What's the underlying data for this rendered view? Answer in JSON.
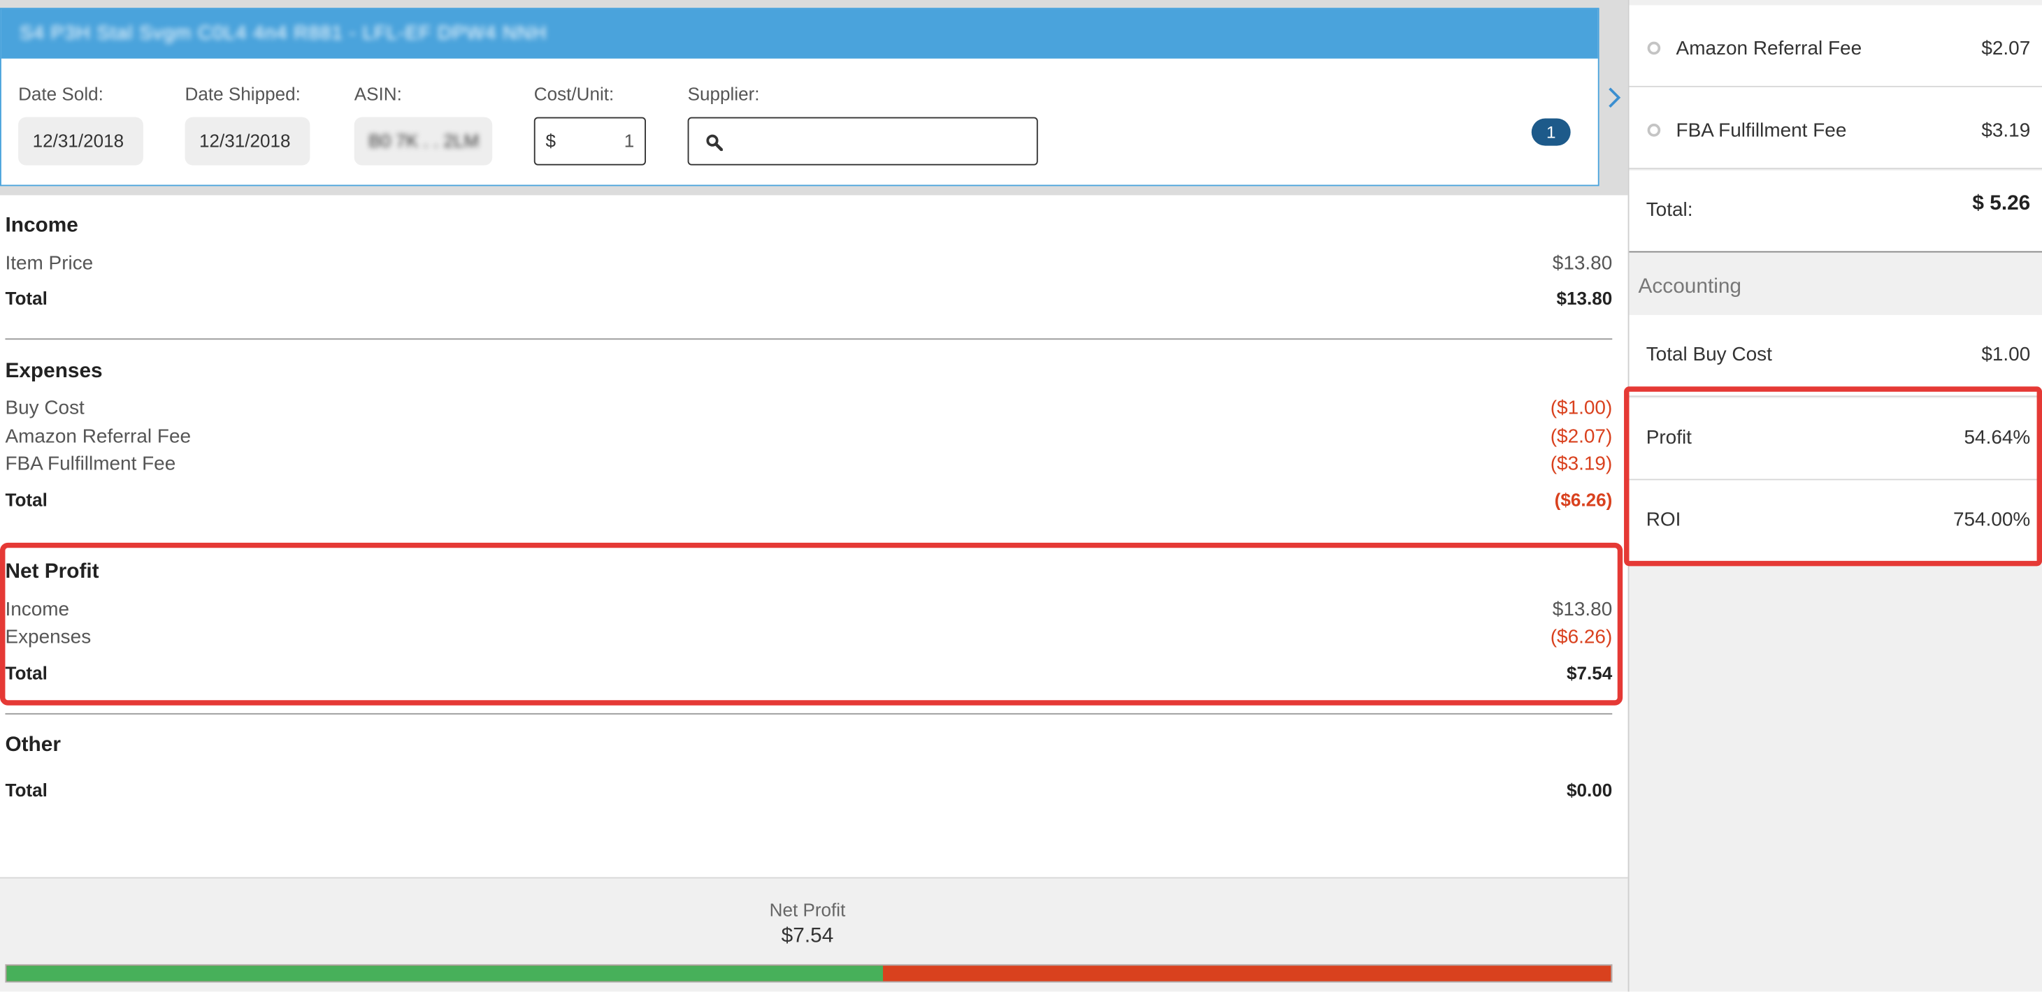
{
  "order_card": {
    "title": "S4 P3H Stal Svgm C0L4 4n4 R881 - LFL-EF DPW4 NNH",
    "date_sold_label": "Date Sold:",
    "date_sold": "12/31/2018",
    "date_shipped_label": "Date Shipped:",
    "date_shipped": "12/31/2018",
    "asin_label": "ASIN:",
    "asin": "B0 7K . . 2LM",
    "cost_unit_label": "Cost/Unit:",
    "cost_currency": "$",
    "cost_value": "1",
    "supplier_label": "Supplier:",
    "supplier_value": "",
    "badge_count": "1"
  },
  "income": {
    "title": "Income",
    "item_price_label": "Item Price",
    "item_price": "$13.80",
    "total_label": "Total",
    "total": "$13.80"
  },
  "expenses": {
    "title": "Expenses",
    "buy_cost_label": "Buy Cost",
    "buy_cost": "($1.00)",
    "referral_label": "Amazon Referral Fee",
    "referral": "($2.07)",
    "fba_label": "FBA Fulfillment Fee",
    "fba": "($3.19)",
    "total_label": "Total",
    "total": "($6.26)"
  },
  "net_profit": {
    "title": "Net Profit",
    "income_label": "Income",
    "income": "$13.80",
    "expenses_label": "Expenses",
    "expenses": "($6.26)",
    "total_label": "Total",
    "total": "$7.54"
  },
  "other": {
    "title": "Other",
    "total_label": "Total",
    "total": "$0.00"
  },
  "summary": {
    "label": "Net Profit",
    "value": "$7.54",
    "profit_fraction": 0.5464
  },
  "fees_panel": {
    "referral_label": "Amazon Referral Fee",
    "referral": "$2.07",
    "fba_label": "FBA Fulfillment Fee",
    "fba": "$3.19",
    "total_label": "Total:",
    "total": "$ 5.26"
  },
  "accounting": {
    "title": "Accounting",
    "buy_cost_label": "Total Buy Cost",
    "buy_cost": "$1.00",
    "profit_label": "Profit",
    "profit": "54.64%",
    "roi_label": "ROI",
    "roi": "754.00%"
  },
  "colors": {
    "header_blue": "#4aa3dc",
    "badge_navy": "#1d5a8a",
    "negative_red": "#d9411e",
    "highlight_red": "#e53935",
    "profit_green": "#47b05a"
  },
  "icons": [
    "search-icon",
    "chevron-right-icon",
    "radio-icon"
  ]
}
